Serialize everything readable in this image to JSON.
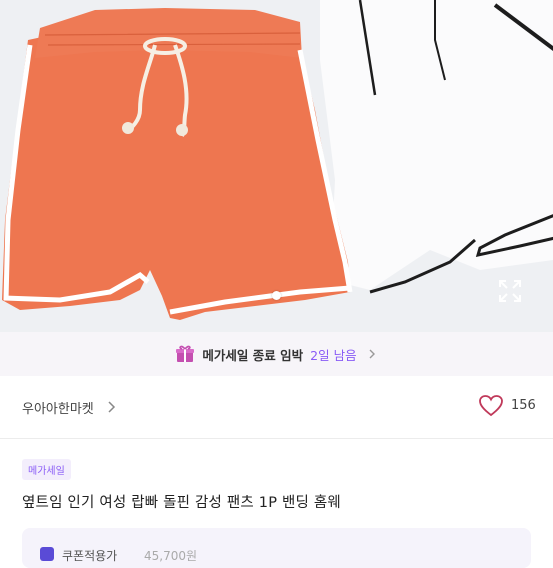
{
  "hero": {
    "image_description": "orange and white banded shorts",
    "pagination_active": 1,
    "expand_icon": "expand-icon"
  },
  "banner": {
    "icon": "gift-icon",
    "title": "메가세일 종료 임박",
    "remain": "2일 남음",
    "accent": "#8a5cf6"
  },
  "seller": {
    "name": "우아아한마켓",
    "like_count": "156"
  },
  "product": {
    "badge": "메가세일",
    "title": "옆트임 인기 여성 랍빠 돌핀 감성 팬츠 1P 밴딩 홈웨"
  },
  "coupon": {
    "label": "쿠폰적용가",
    "price": "45,700원"
  }
}
